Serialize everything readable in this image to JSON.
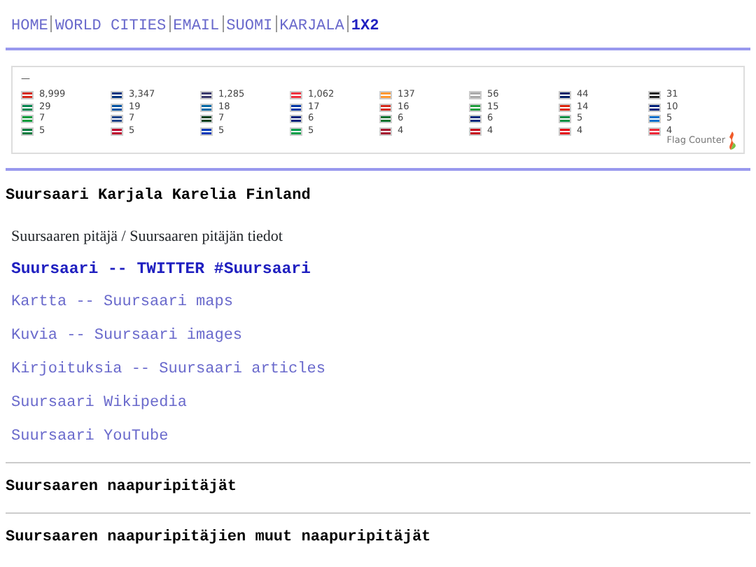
{
  "nav": [
    {
      "label": "HOME",
      "current": false
    },
    {
      "label": "WORLD CITIES",
      "current": false
    },
    {
      "label": "EMAIL",
      "current": false
    },
    {
      "label": "SUOMI",
      "current": false
    },
    {
      "label": "KARJALA",
      "current": false
    },
    {
      "label": "1X2",
      "current": true
    }
  ],
  "flag_counter": {
    "dash": "—",
    "footer": "Flag Counter",
    "entries": [
      {
        "count": "8,999",
        "color": "#d52b1e"
      },
      {
        "count": "3,347",
        "color": "#003580"
      },
      {
        "count": "1,285",
        "color": "#3c3b6e"
      },
      {
        "count": "1,062",
        "color": "#ef3340"
      },
      {
        "count": "137",
        "color": "#ff9933"
      },
      {
        "count": "56",
        "color": "#aaaaaa"
      },
      {
        "count": "44",
        "color": "#012169"
      },
      {
        "count": "31",
        "color": "#222222"
      },
      {
        "count": "29",
        "color": "#008751"
      },
      {
        "count": "19",
        "color": "#0055a4"
      },
      {
        "count": "18",
        "color": "#006aa7"
      },
      {
        "count": "17",
        "color": "#0038a8"
      },
      {
        "count": "16",
        "color": "#d52b1e"
      },
      {
        "count": "15",
        "color": "#239f40"
      },
      {
        "count": "14",
        "color": "#de2910"
      },
      {
        "count": "10",
        "color": "#00247d"
      },
      {
        "count": "7",
        "color": "#009c3b"
      },
      {
        "count": "7",
        "color": "#21468b"
      },
      {
        "count": "7",
        "color": "#01411c"
      },
      {
        "count": "6",
        "color": "#00247d"
      },
      {
        "count": "6",
        "color": "#00732f"
      },
      {
        "count": "6",
        "color": "#002b7f"
      },
      {
        "count": "5",
        "color": "#009246"
      },
      {
        "count": "5",
        "color": "#0072ce"
      },
      {
        "count": "5",
        "color": "#007a3d"
      },
      {
        "count": "5",
        "color": "#bc002d"
      },
      {
        "count": "5",
        "color": "#0038b8"
      },
      {
        "count": "5",
        "color": "#009e49"
      },
      {
        "count": "4",
        "color": "#a51931"
      },
      {
        "count": "4",
        "color": "#c60b1e"
      },
      {
        "count": "4",
        "color": "#e30a17"
      },
      {
        "count": "4",
        "color": "#ed2939"
      }
    ]
  },
  "title": "Suursaari Karjala Karelia Finland",
  "subtitle": "Suursaaren pitäjä / Suursaaren pitäjän tiedot",
  "links": [
    {
      "label": "Suursaari -- TWITTER #Suursaari",
      "featured": true
    },
    {
      "label": "Kartta -- Suursaari maps",
      "featured": false
    },
    {
      "label": "Kuvia -- Suursaari images",
      "featured": false
    },
    {
      "label": "Kirjoituksia -- Suursaari articles",
      "featured": false
    },
    {
      "label": "Suursaari Wikipedia",
      "featured": false
    },
    {
      "label": "Suursaari YouTube",
      "featured": false
    }
  ],
  "sections": [
    "Suursaaren naapuripitäjät",
    "Suursaaren naapuripitäjien muut naapuripitäjät"
  ]
}
